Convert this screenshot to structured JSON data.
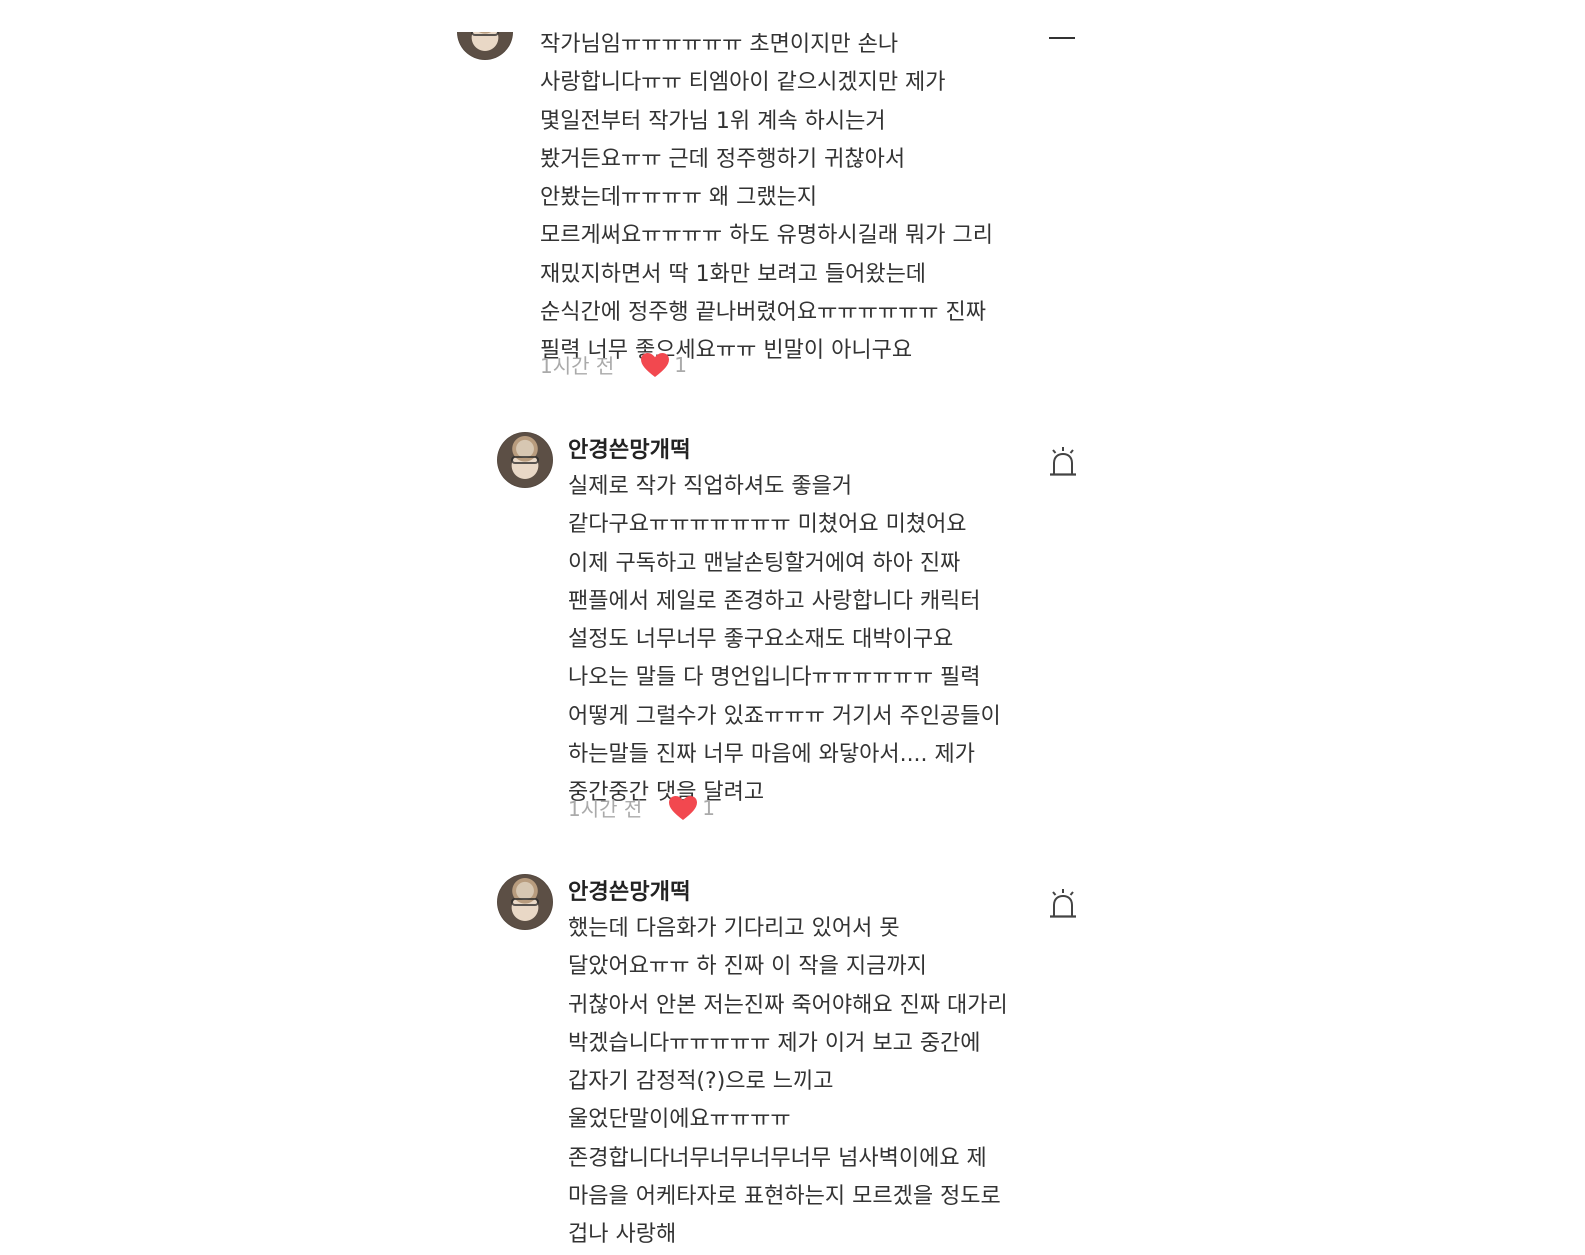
{
  "comments": [
    {
      "username": "",
      "content": "작가님임ㅠㅠㅠㅠㅠㅠ 초면이지만 손나 사랑합니다ㅠㅠ 티엠아이 같으시겠지만 제가 몇일전부터 작가님 1위 계속 하시는거 봤거든요ㅠㅠ 근데 정주행하기 귀찮아서 안봤는데ㅠㅠㅠㅠ 왜 그랬는지 모르게써요ㅠㅠㅠㅠ 하도 유명하시길래 뭐가 그리 재밌지하면서 딱 1화만 보려고 들어왔는데 순식간에 정주행 끝나버렸어요ㅠㅠㅠㅠㅠㅠ 진짜 필력 너무 좋으세요ㅠㅠ 빈말이 아니구요",
      "time": "1시간 전",
      "likes": "1"
    },
    {
      "username": "안경쓴망개떡",
      "content": "실제로 작가 직업하셔도 좋을거 같다구요ㅠㅠㅠㅠㅠㅠㅠ 미쳤어요 미쳤어요 이제 구독하고 맨날손팅할거에여 하아 진짜 팬플에서 제일로 존경하고 사랑합니다 캐릭터 설정도 너무너무 좋구요소재도 대박이구요 나오는 말들 다 명언입니다ㅠㅠㅠㅠㅠㅠ 필력 어떻게 그럴수가 있죠ㅠㅠㅠ 거기서 주인공들이 하는말들 진짜 너무 마음에 와닿아서.... 제가 중간중간 댓을 달려고",
      "time": "1시간 전",
      "likes": "1"
    },
    {
      "username": "안경쓴망개떡",
      "content": "했는데 다음화가 기다리고 있어서 못 달았어요ㅠㅠ 하 진짜 이 작을 지금까지 귀찮아서 안본 저는진짜 죽어야해요 진짜 대가리 박겠습니다ㅠㅠㅠㅠㅠ 제가 이거 보고 중간에 갑자기 감정적(?)으로 느끼고 울었단말이에요ㅠㅠㅠㅠ 존경합니다너무너무너무너무 넘사벽이에요 제 마음을 어케타자로 표현하는지 모르겠을 정도로 겁나 사랑해",
      "time": "",
      "likes": ""
    }
  ],
  "colors": {
    "heart": "#f2484f",
    "meta_text": "#aaaaaa",
    "body_text": "#333333"
  },
  "icons": {
    "report": "siren-icon",
    "like": "heart-icon",
    "menu": "dash-icon"
  }
}
